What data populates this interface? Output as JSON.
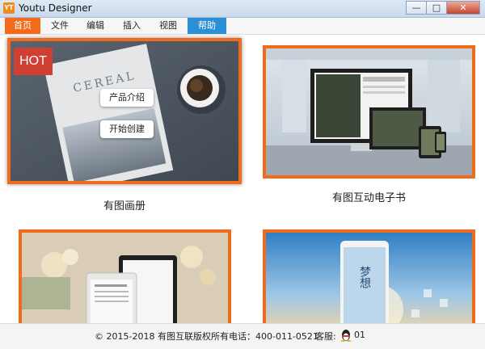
{
  "window": {
    "title": "Youtu Designer",
    "app_icon_text": "YT",
    "min_glyph": "—",
    "max_glyph": "□",
    "close_glyph": "✕"
  },
  "menu": {
    "items": [
      "首页",
      "文件",
      "编辑",
      "插入",
      "视图",
      "帮助"
    ]
  },
  "cards": [
    {
      "label": "有图画册",
      "badge": "HOT",
      "actions": [
        "产品介绍",
        "开始创建"
      ],
      "cover_text": "CEREAL"
    },
    {
      "label": "有图互动电子书"
    },
    {
      "label": ""
    },
    {
      "label": "",
      "poster_text": "梦想"
    }
  ],
  "footer": {
    "copyright": "© 2015-2018 有图互联版权所有",
    "phone": "电话：400-011-0521",
    "service": "客服:",
    "qq_partial": "01"
  },
  "colors": {
    "accent": "#f26b1d",
    "help_tab": "#2c8fd6",
    "hot_badge": "#d04032"
  }
}
